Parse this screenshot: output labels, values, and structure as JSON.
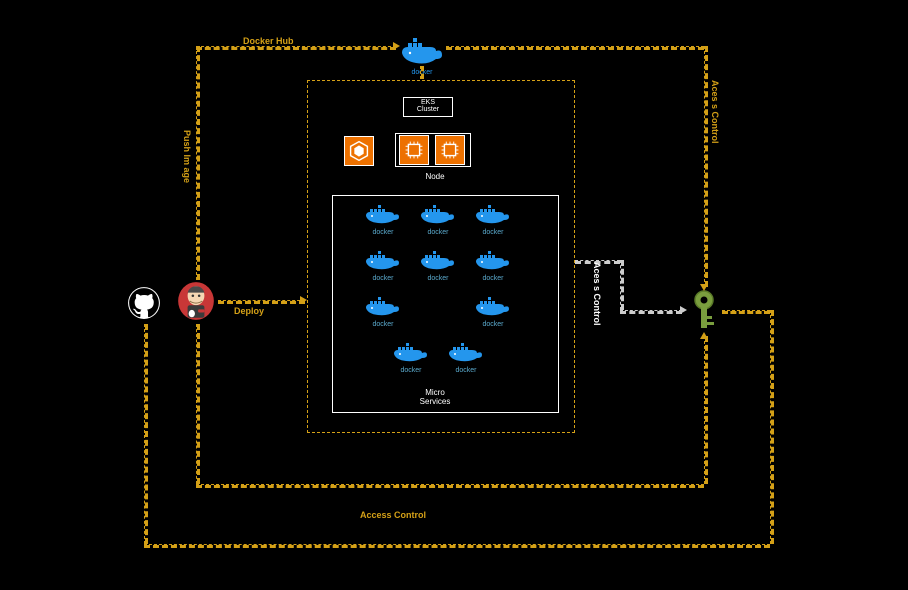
{
  "labels": {
    "docker_hub": "Docker Hub",
    "push_image": "Push Im age",
    "deploy": "Deploy",
    "access_control_bottom": "Access Control",
    "access_control_right_top": "Aces s Control",
    "access_control_right_mid": "Aces s Control",
    "eks": "EKS",
    "cluster": "Cluster",
    "node": "Node",
    "micro": "Micro",
    "services": "Services",
    "docker": "docker"
  },
  "icons": {
    "github": "github-icon",
    "jenkins": "jenkins-icon",
    "docker_hub": "docker-hub-icon",
    "key": "key-icon",
    "eks_service": "aws-eks-icon",
    "ec2_node": "aws-ec2-icon"
  }
}
